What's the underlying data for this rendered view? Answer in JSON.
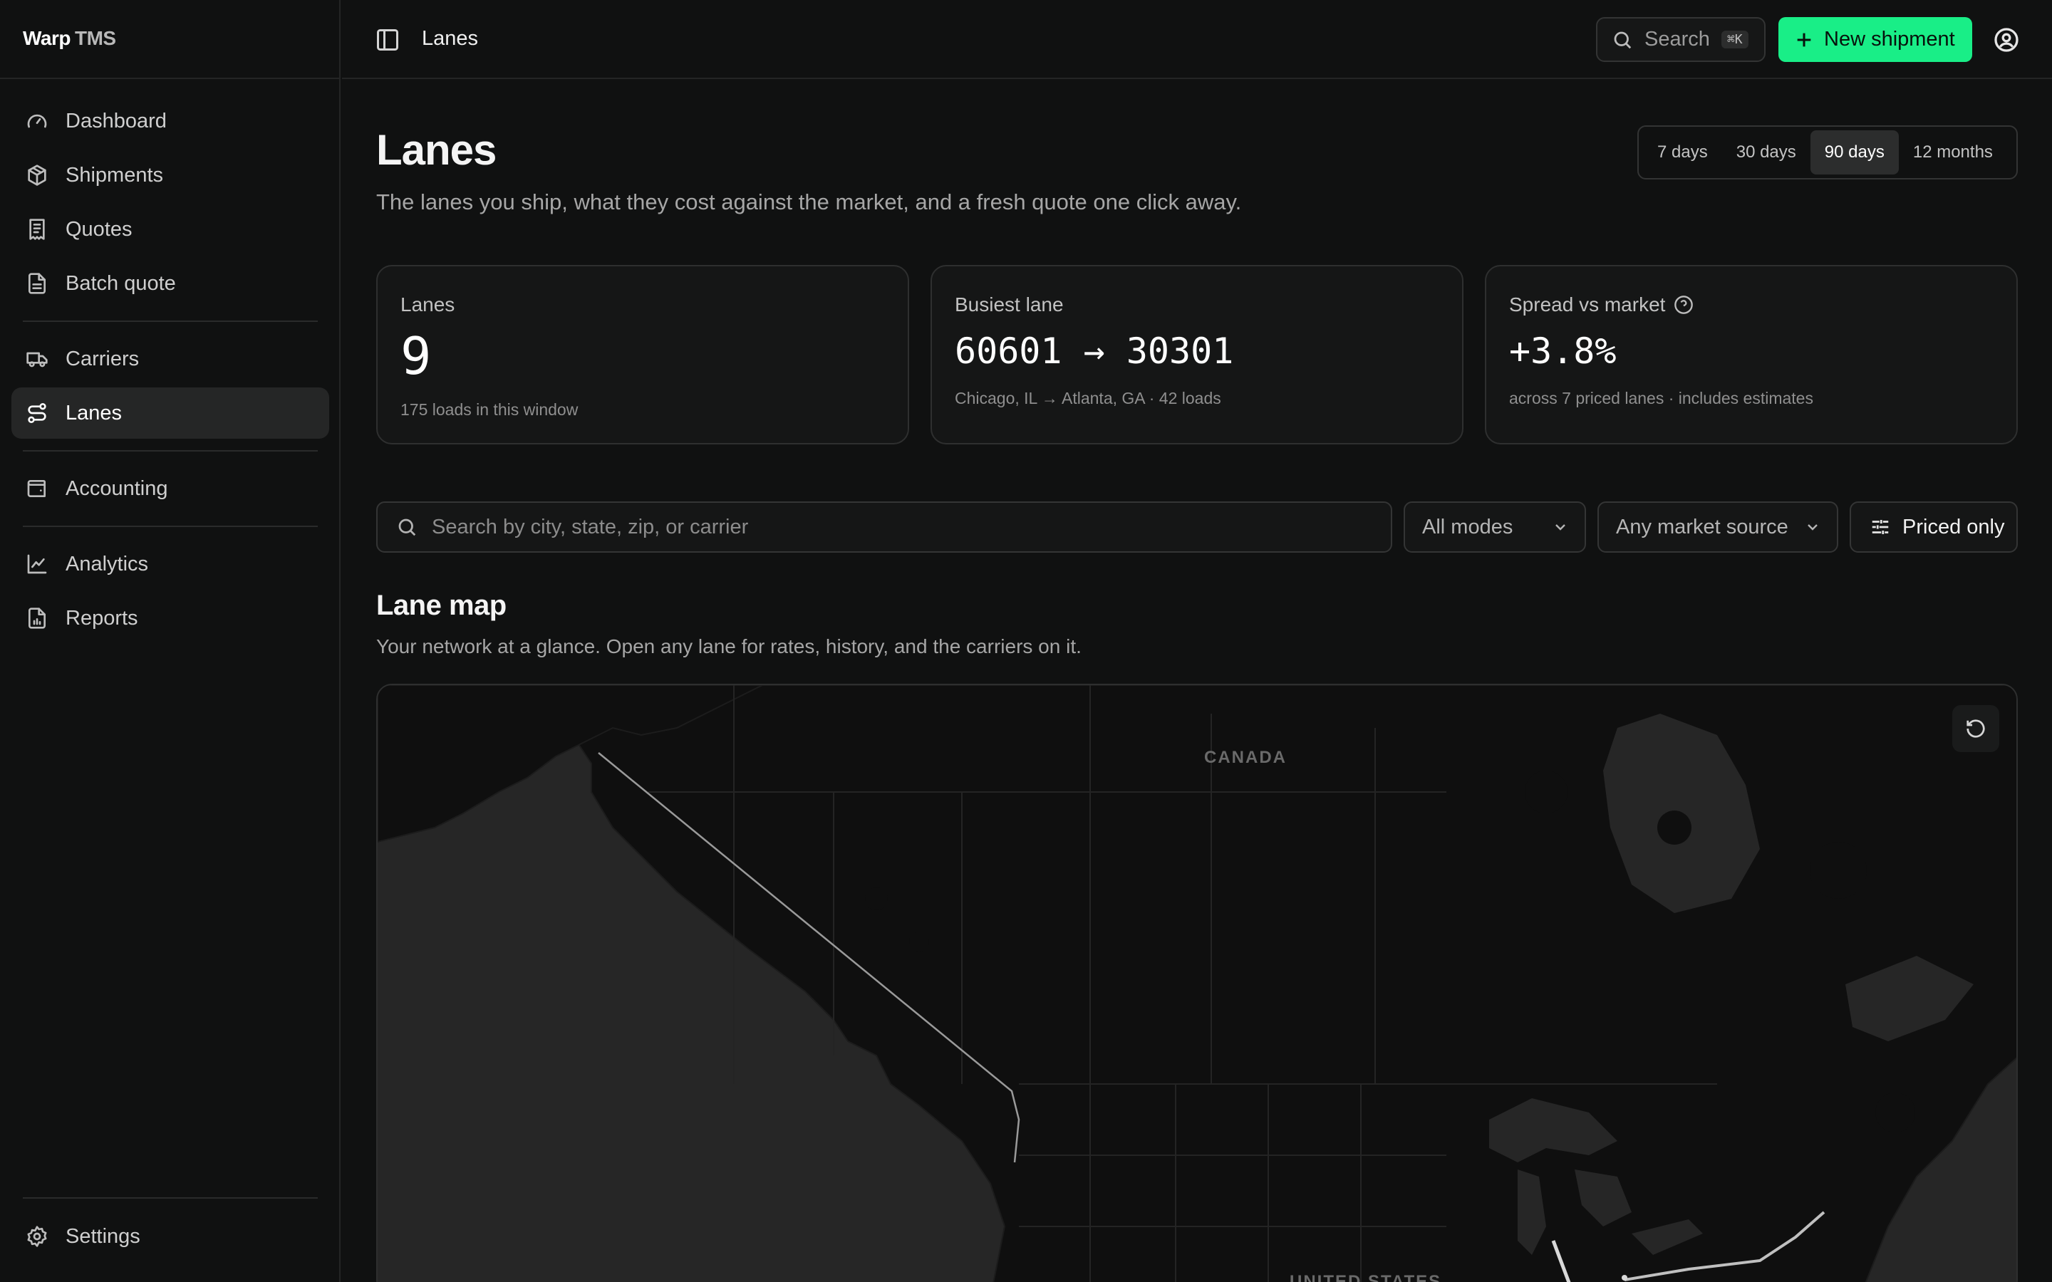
{
  "app": {
    "brand_primary": "Warp",
    "brand_secondary": "TMS"
  },
  "sidebar": {
    "items": [
      {
        "label": "Dashboard",
        "icon": "gauge-icon"
      },
      {
        "label": "Shipments",
        "icon": "package-icon"
      },
      {
        "label": "Quotes",
        "icon": "receipt-icon"
      },
      {
        "label": "Batch quote",
        "icon": "file-stack-icon"
      },
      {
        "label": "Carriers",
        "icon": "truck-icon"
      },
      {
        "label": "Lanes",
        "icon": "route-icon",
        "active": true
      },
      {
        "label": "Accounting",
        "icon": "wallet-icon"
      },
      {
        "label": "Analytics",
        "icon": "line-chart-icon"
      },
      {
        "label": "Reports",
        "icon": "file-chart-icon"
      }
    ],
    "settings_label": "Settings"
  },
  "topbar": {
    "breadcrumb": "Lanes",
    "search_label": "Search",
    "search_shortcut": "⌘K",
    "new_shipment_label": "New shipment"
  },
  "page": {
    "title": "Lanes",
    "subtitle": "The lanes you ship, what they cost against the market, and a fresh quote one click away.",
    "ranges": [
      "7 days",
      "30 days",
      "90 days",
      "12 months"
    ],
    "selected_range": "90 days"
  },
  "stats": {
    "lanes": {
      "label": "Lanes",
      "value": "9",
      "note": "175 loads in this window"
    },
    "busiest": {
      "label": "Busiest lane",
      "value": "60601 → 30301",
      "note": "Chicago, IL → Atlanta, GA · 42 loads"
    },
    "spread": {
      "label": "Spread vs market",
      "value": "+3.8%",
      "note": "across 7 priced lanes · includes estimates"
    }
  },
  "filters": {
    "search_placeholder": "Search by city, state, zip, or carrier",
    "mode": "All modes",
    "market_source": "Any market source",
    "priced_only_label": "Priced only"
  },
  "lane_map": {
    "title": "Lane map",
    "subtitle": "Your network at a glance. Open any lane for rates, history, and the carriers on it.",
    "labels": {
      "canada": "CANADA",
      "united_states": "UNITED STATES"
    }
  },
  "colors": {
    "accent": "#19ee87",
    "background": "#101111",
    "map_land": "#0f0f0f",
    "map_water": "#262626"
  }
}
